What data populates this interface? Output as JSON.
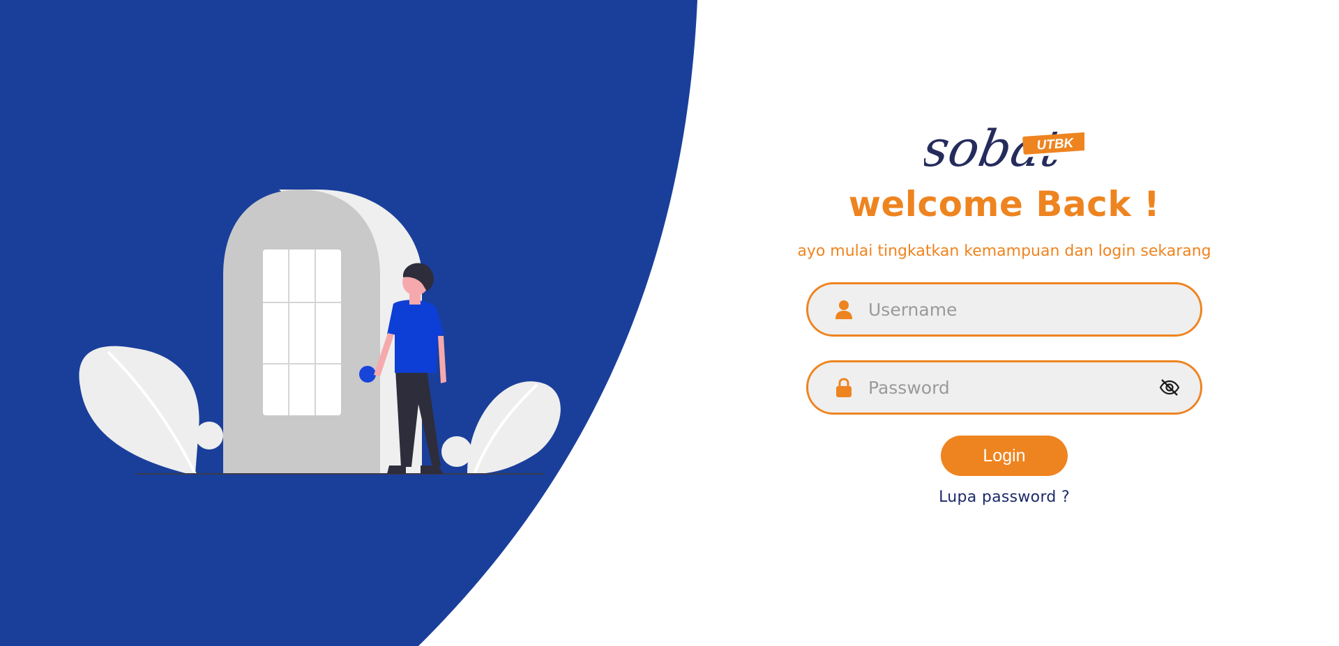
{
  "colors": {
    "primary_blue": "#1a3f9b",
    "accent_orange": "#ee8420",
    "field_bg": "#efefef",
    "link_navy": "#1b2a6b"
  },
  "logo": {
    "script_text": "sobat",
    "tag_text": "UTBK"
  },
  "login": {
    "title": "welcome Back !",
    "subtitle": "ayo mulai tingkatkan kemampuan dan login sekarang",
    "username": {
      "placeholder": "Username",
      "value": "",
      "icon": "user-icon"
    },
    "password": {
      "placeholder": "Password",
      "value": "",
      "icon": "lock-icon",
      "toggle_icon": "eye-off-icon"
    },
    "button_label": "Login",
    "forgot_label": "Lupa password ?"
  }
}
